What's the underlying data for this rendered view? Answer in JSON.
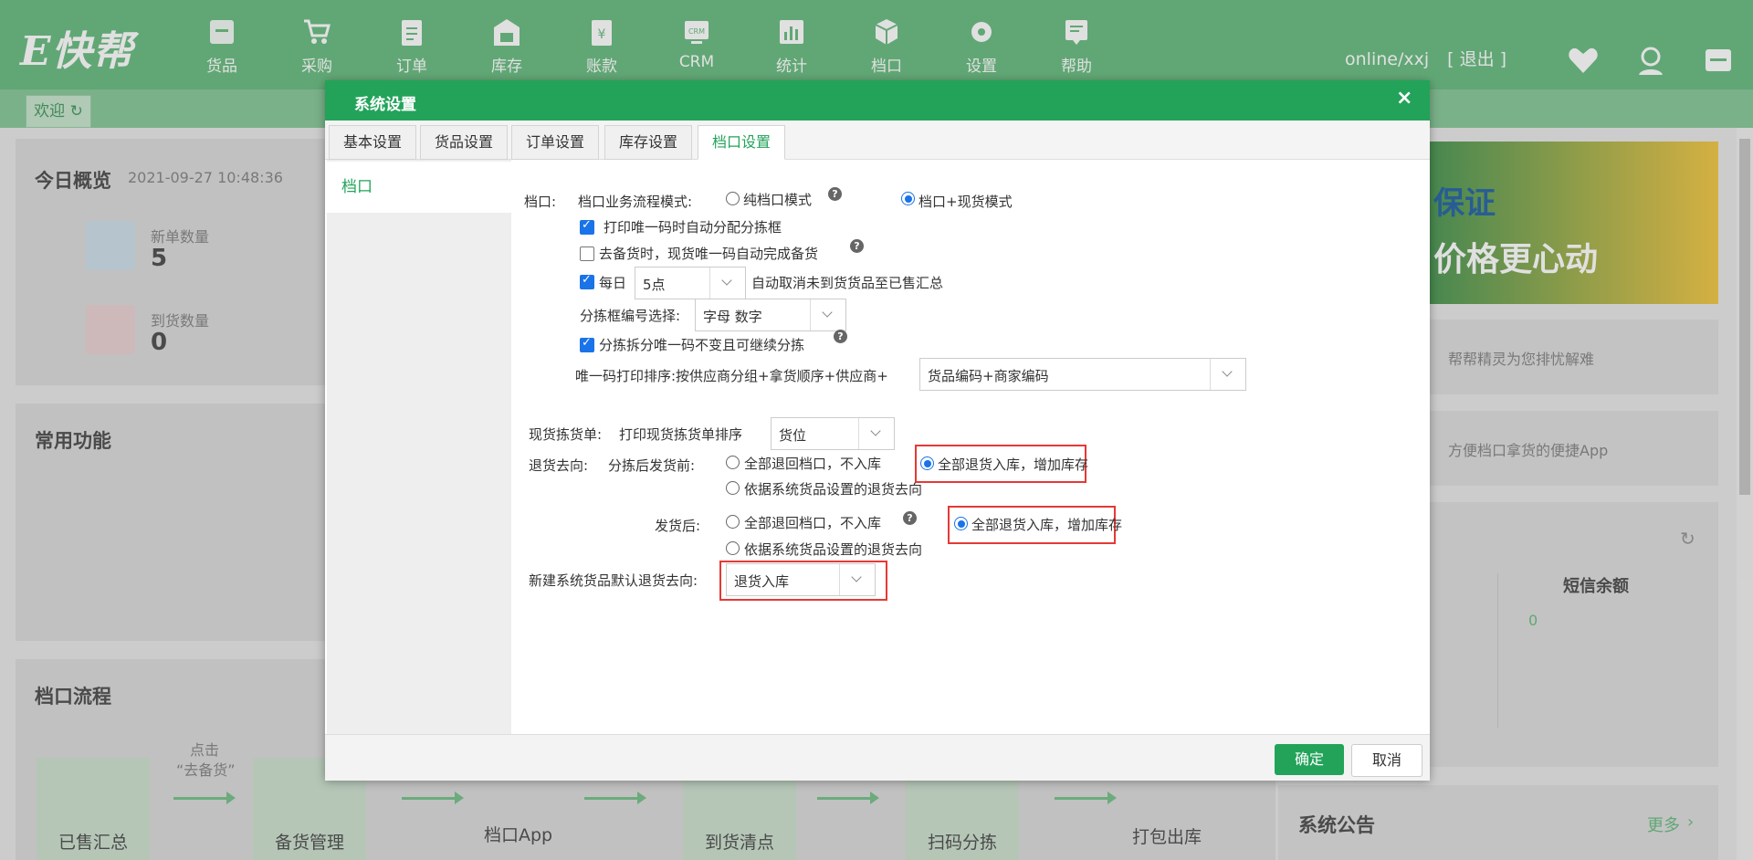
{
  "header": {
    "logo": "E快帮",
    "nav": [
      "货品",
      "采购",
      "订单",
      "库存",
      "账款",
      "CRM",
      "统计",
      "档口",
      "设置",
      "帮助"
    ],
    "user": "online/xxj",
    "logout": "[ 退出 ]"
  },
  "tabstrip": {
    "welcome": "欢迎 ↻"
  },
  "overview": {
    "title": "今日概览",
    "datetime": "2021-09-27 10:48:36",
    "new_orders_label": "新单数量",
    "new_orders": "5",
    "arrivals_label": "到货数量",
    "arrivals": "0"
  },
  "common": {
    "title": "常用功能"
  },
  "flow": {
    "title": "档口流程",
    "hint1": "点击",
    "hint2": "“去备货”",
    "steps": [
      "已售汇总",
      "备货管理",
      "档口App",
      "到货清点",
      "扫码分拣",
      "打包出库"
    ]
  },
  "right": {
    "banner_text1": "保证",
    "banner_text2": "价格更心动",
    "tip1": "帮帮精灵为您排忧解难",
    "tip2": "方便档口拿货的便捷App",
    "sms_label": "短信余额",
    "sms_value": "0",
    "notice": "系统公告",
    "more": "更多"
  },
  "modal": {
    "title": "系统设置",
    "close": "×",
    "tabs": [
      "基本设置",
      "货品设置",
      "订单设置",
      "库存设置",
      "档口设置"
    ],
    "active_tab": 4,
    "side_item": "档口",
    "row_label": "档口:",
    "mode_label": "档口业务流程模式:",
    "mode_opt1": "纯档口模式",
    "mode_opt2": "档口+现货模式",
    "opt_print": "打印唯一码时自动分配分拣框",
    "opt_prepare": "去备货时，现货唯一码自动完成备货",
    "opt_daily": "每日",
    "daily_value": "5点",
    "opt_daily_suffix": "自动取消未到货货品至已售汇总",
    "frame_label": "分拣框编号选择:",
    "frame_value": "字母 数字",
    "opt_split": "分拣拆分唯一码不变且可继续分拣",
    "sort_label": "唯一码打印排序:按供应商分组+拿货顺序+供应商+",
    "sort_value": "货品编码+商家编码",
    "stock_label": "现货拣货单:",
    "stock_sort_label": "打印现货拣货单排序",
    "stock_sort_value": "货位",
    "return_label": "退货去向:",
    "before_label": "分拣后发货前:",
    "ret_opt1": "全部退回档口，不入库",
    "ret_opt2": "全部退货入库，增加库存",
    "ret_opt3": "依据系统货品设置的退货去向",
    "after_label": "发货后:",
    "new_label": "新建系统货品默认退货去向:",
    "new_value": "退货入库",
    "ok": "确定",
    "cancel": "取消"
  }
}
